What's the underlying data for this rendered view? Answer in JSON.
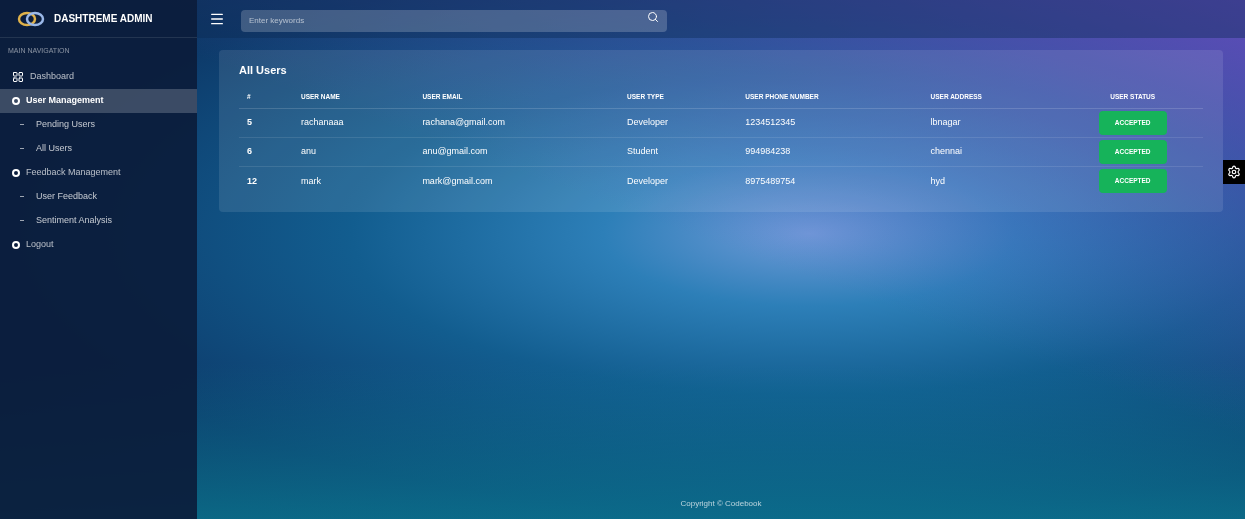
{
  "brand": "DASHTREME ADMIN",
  "search": {
    "placeholder": "Enter keywords"
  },
  "sidebar": {
    "header": "MAIN NAVIGATION",
    "items": [
      {
        "label": "Dashboard",
        "kind": "grid",
        "selected": false
      },
      {
        "label": "User Management",
        "kind": "circle",
        "selected": true,
        "children": [
          {
            "label": "Pending Users",
            "selected": false
          },
          {
            "label": "All Users",
            "selected": false
          }
        ]
      },
      {
        "label": "Feedback Management",
        "kind": "circle",
        "selected": false,
        "children": [
          {
            "label": "User Feedback",
            "selected": false
          },
          {
            "label": "Sentiment Analysis",
            "selected": false
          }
        ]
      },
      {
        "label": "Logout",
        "kind": "circle",
        "selected": false
      }
    ]
  },
  "card": {
    "title": "All Users"
  },
  "table": {
    "columns": [
      "#",
      "USER NAME",
      "USER EMAIL",
      "USER TYPE",
      "USER PHONE NUMBER",
      "USER ADDRESS",
      "USER STATUS"
    ],
    "rows": [
      [
        "5",
        "rachanaaa",
        "rachana@gmail.com",
        "Developer",
        "1234512345",
        "lbnagar",
        "ACCEPTED"
      ],
      [
        "6",
        "anu",
        "anu@gmail.com",
        "Student",
        "994984238",
        "chennai",
        "ACCEPTED"
      ],
      [
        "12",
        "mark",
        "mark@gmail.com",
        "Developer",
        "8975489754",
        "hyd",
        "ACCEPTED"
      ]
    ]
  },
  "footer": "Copyright © Codebook"
}
